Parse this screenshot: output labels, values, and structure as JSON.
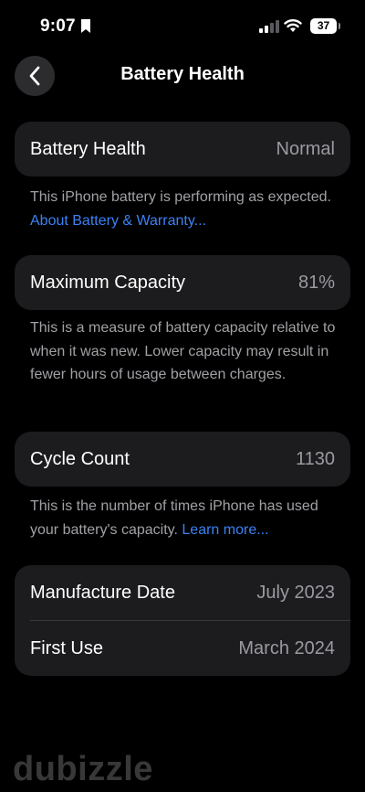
{
  "status_bar": {
    "time": "9:07",
    "battery_level": "37"
  },
  "nav": {
    "title": "Battery Health"
  },
  "battery_health": {
    "label": "Battery Health",
    "value": "Normal",
    "note": "This iPhone battery is performing as expected.",
    "link": "About Battery & Warranty..."
  },
  "maximum_capacity": {
    "label": "Maximum Capacity",
    "value": "81%",
    "note": "This is a measure of battery capacity relative to when it was new. Lower capacity may result in fewer hours of usage between charges."
  },
  "cycle_count": {
    "label": "Cycle Count",
    "value": "1130",
    "note": "This is the number of times iPhone has used your battery's capacity.",
    "link": "Learn more..."
  },
  "dates": {
    "manufacture_label": "Manufacture Date",
    "manufacture_value": "July 2023",
    "first_use_label": "First Use",
    "first_use_value": "March 2024"
  },
  "watermark": "dubizzle"
}
